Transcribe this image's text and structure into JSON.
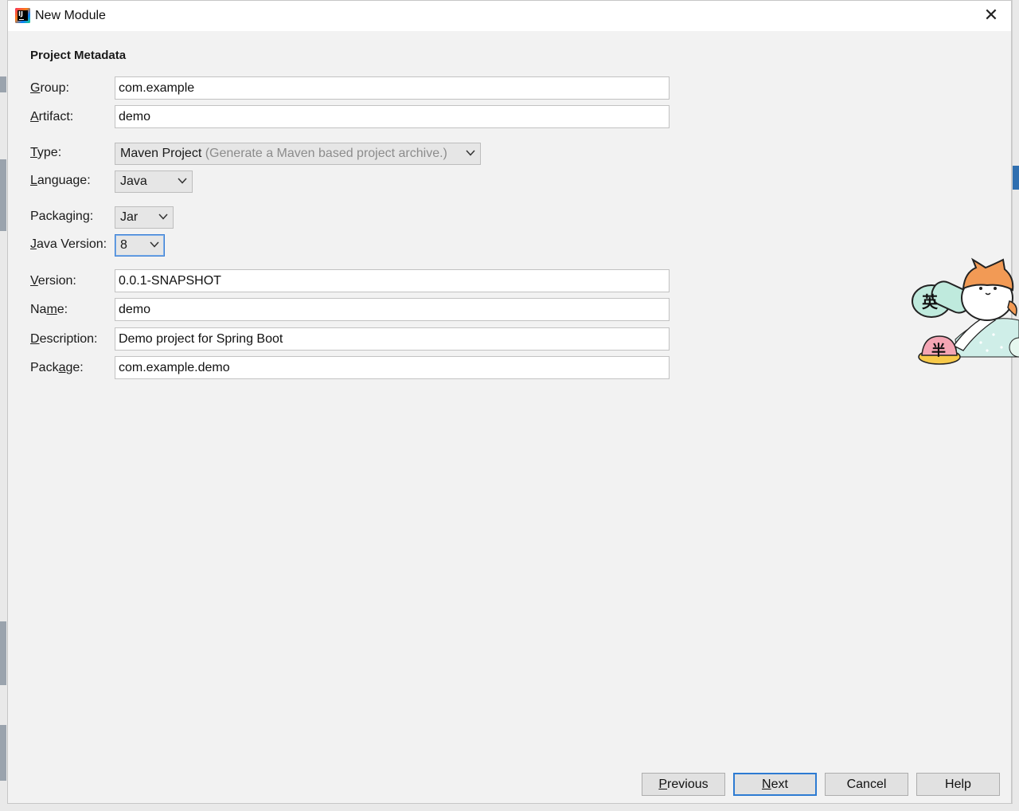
{
  "window": {
    "title": "New Module",
    "close_glyph": "✕"
  },
  "form": {
    "section_title": "Project Metadata",
    "group": {
      "label_mnemonic": "G",
      "label_rest": "roup:",
      "value": "com.example"
    },
    "artifact": {
      "label_mnemonic": "A",
      "label_rest": "rtifact:",
      "value": "demo"
    },
    "type": {
      "label_mnemonic": "T",
      "label_rest": "ype:",
      "value": "Maven Project",
      "hint": "(Generate a Maven based project archive.)"
    },
    "language": {
      "label_mnemonic": "L",
      "label_rest": "anguage:",
      "value": "Java"
    },
    "packaging": {
      "label_pre": "Packaging:",
      "value": "Jar"
    },
    "java_version": {
      "label_mnemonic": "J",
      "label_rest": "ava Version:",
      "value": "8"
    },
    "version": {
      "label_mnemonic": "V",
      "label_rest": "ersion:",
      "value": "0.0.1-SNAPSHOT"
    },
    "name": {
      "label_pre": "Na",
      "label_mnemonic": "m",
      "label_rest": "e:",
      "value": "demo"
    },
    "description": {
      "label_mnemonic": "D",
      "label_rest": "escription:",
      "value": "Demo project for Spring Boot"
    },
    "package": {
      "label_pre": "Pack",
      "label_mnemonic": "a",
      "label_rest": "ge:",
      "value": "com.example.demo"
    }
  },
  "buttons": {
    "previous": {
      "mnemonic": "P",
      "rest": "revious"
    },
    "next": {
      "mnemonic": "N",
      "rest": "ext"
    },
    "cancel": {
      "label": "Cancel"
    },
    "help": {
      "label": "Help"
    }
  },
  "overlay": {
    "badge_top": "英",
    "badge_bottom": "半"
  },
  "icons": {
    "app": "intellij-idea-icon",
    "chevron": "chevron-down-icon"
  }
}
